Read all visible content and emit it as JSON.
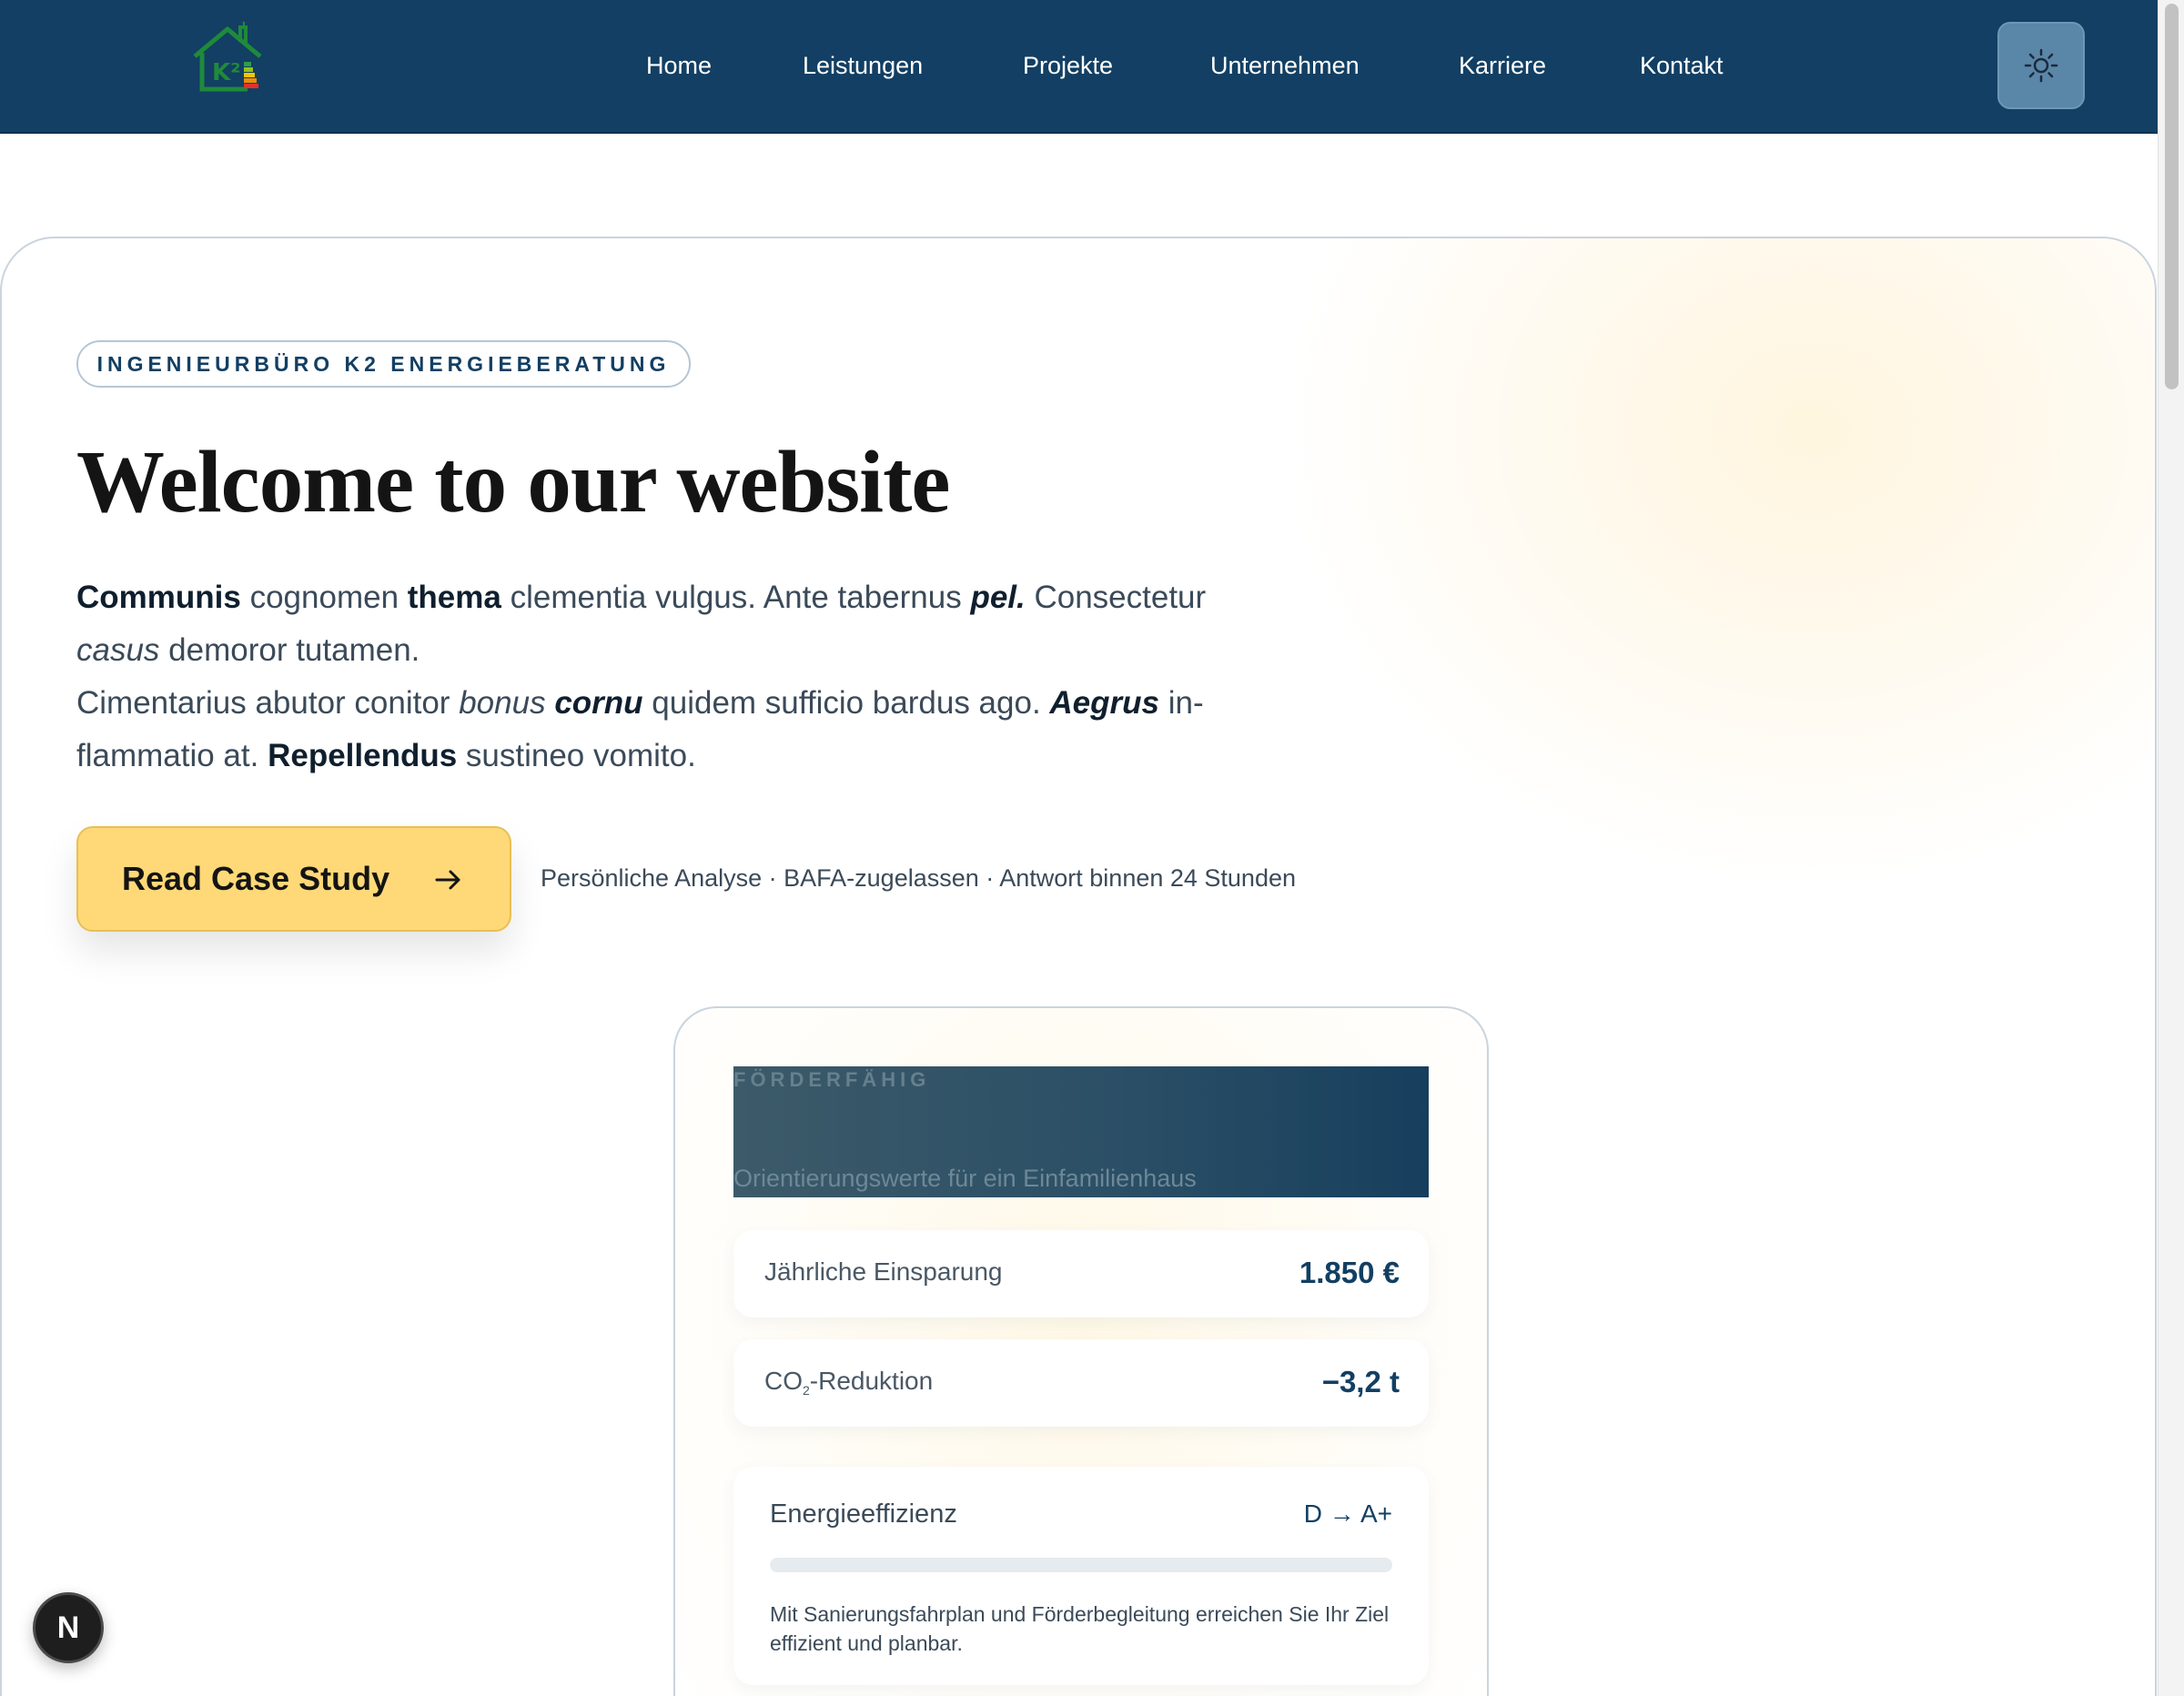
{
  "nav": {
    "logo_text": "K²",
    "items": [
      {
        "label": "Home"
      },
      {
        "label": "Leistungen"
      },
      {
        "label": "Projekte"
      },
      {
        "label": "Unternehmen"
      },
      {
        "label": "Karriere"
      },
      {
        "label": "Kontakt"
      }
    ],
    "theme_toggle_icon": "sun-icon"
  },
  "hero": {
    "eyebrow": "INGENIEURBÜRO K2 ENERGIEBERATUNG",
    "title": "Welcome to our website",
    "paragraph": {
      "p1": [
        "Communis",
        " cognomen ",
        "thema",
        " clementia vulgus. Ante tabernus ",
        "pel.",
        " Consectetur ",
        "casus",
        " demoror tutamen."
      ],
      "p2": [
        "Cimentarius abutor conitor ",
        "bonus",
        " ",
        "cornu",
        " quidem sufficio bardus ago. ",
        "Aegrus",
        " in-flammatio at. ",
        "Repellendus",
        " sustineo vomito."
      ]
    },
    "cta_label": "Read Case Study",
    "cta_icon": "arrow-right-icon",
    "cta_note": "Persönliche Analyse · BAFA-zugelassen · Antwort binnen 24 Stunden"
  },
  "card": {
    "kicker": "FÖRDERFÄHIG",
    "subtitle": "Orientierungswerte für ein Einfamilienhaus",
    "metrics": [
      {
        "label": "Jährliche Einsparung",
        "value": "1.850 €"
      },
      {
        "label_prefix": "CO",
        "label_sub": "2",
        "label_suffix": "-Reduktion",
        "value": "−3,2 t"
      }
    ],
    "efficiency": {
      "label": "Energieeffizienz",
      "rating": "D → A+",
      "progress": 0,
      "description": "Mit Sanierungsfahrplan und Förderbegleitung erreichen Sie Ihr Ziel effizient und planbar."
    }
  },
  "dev_badge": "N",
  "colors": {
    "nav_bg": "#123f63",
    "accent": "#ffd978",
    "brand_dark": "#123f63"
  }
}
